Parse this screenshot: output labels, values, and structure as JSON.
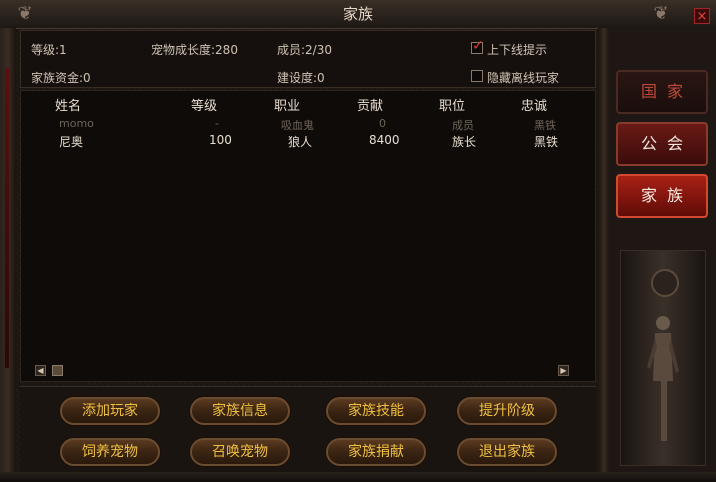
{
  "window": {
    "title": "家族",
    "close_label": "×",
    "corner_left": "❦",
    "corner_right": "❦"
  },
  "info": {
    "level": "等级:1",
    "pet_growth": "宠物成长度:280",
    "members": "成员:2/30",
    "funds": "家族资金:0",
    "construction": "建设度:0",
    "online_notify": {
      "label": "上下线提示",
      "checked": true
    },
    "hide_offline": {
      "label": "隐藏离线玩家",
      "checked": false
    }
  },
  "table": {
    "headers": [
      "姓名",
      "等级",
      "职业",
      "贡献",
      "职位",
      "忠诚"
    ],
    "rows": [
      [
        "momo",
        "-",
        "吸血鬼",
        "0",
        "成员",
        "黑铁"
      ],
      [
        "尼奥",
        "100",
        "狼人",
        "8400",
        "族长",
        "黑铁"
      ]
    ]
  },
  "buttons": {
    "add_player": "添加玩家",
    "family_info": "家族信息",
    "family_skills": "家族技能",
    "upgrade_rank": "提升阶级",
    "feed_pet": "饲养宠物",
    "summon_pet": "召唤宠物",
    "family_donate": "家族捐献",
    "leave_family": "退出家族"
  },
  "side_tabs": {
    "nation": "国家",
    "guild": "公会",
    "family": "家族"
  },
  "scroll": {
    "left": "◀",
    "right": "▶"
  },
  "colors": {
    "accent_gold": "#f0c040",
    "active_tab": "#a82014",
    "close_red": "#e04a3a"
  }
}
